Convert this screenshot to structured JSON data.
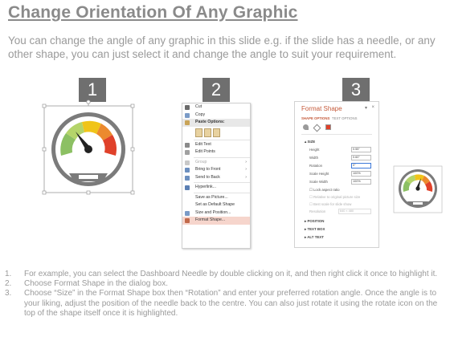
{
  "title": "Change Orientation Of Any Graphic",
  "intro": "You can change the angle of any graphic in this slide e.g. if the slide has a needle, or any other shape, you can just select it and change the angle to suit your requirement.",
  "step_numbers": [
    "1",
    "2",
    "3"
  ],
  "menu": {
    "cut": "Cut",
    "copy": "Copy",
    "paste_options": "Paste Options:",
    "edit_text": "Edit Text",
    "edit_points": "Edit Points",
    "group": "Group",
    "bring_to_front": "Bring to Front",
    "send_to_back": "Send to Back",
    "hyperlink": "Hyperlink...",
    "save_as_picture": "Save as Picture...",
    "set_default_shape": "Set as Default Shape",
    "size_and_position": "Size and Position...",
    "format_shape": "Format Shape..."
  },
  "pane": {
    "title": "Format Shape",
    "tab_shape": "SHAPE OPTIONS",
    "tab_text": "TEXT OPTIONS",
    "section_size": "SIZE",
    "height_label": "Height",
    "height_value": "0.55\"",
    "width_label": "Width",
    "width_value": "0.60\"",
    "rotation_label": "Rotation",
    "rotation_value": "0°",
    "scale_height_label": "Scale Height",
    "scale_height_value": "100%",
    "scale_width_label": "Scale Width",
    "scale_width_value": "100%",
    "lock_aspect": "Lock aspect ratio",
    "relative_original": "Relative to original picture size",
    "best_scale": "Best scale for slide show",
    "resolution_label": "Resolution",
    "resolution_value": "640 × 480",
    "section_position": "POSITION",
    "section_textbox": "TEXT BOX",
    "section_alttext": "ALT TEXT"
  },
  "steps": [
    {
      "n": "1.",
      "text": "For example, you can select the Dashboard Needle by double clicking on it, and then right click it once to highlight it."
    },
    {
      "n": "2.",
      "text": "Choose Format Shape in the dialog box."
    },
    {
      "n": "3.",
      "text": "Choose “Size” in the Format Shape box then “Rotation” and enter your preferred rotation angle. Once the angle is to your liking, adjust the position of the needle back to the centre. You can also just rotate it using the rotate icon on the top of the shape itself once it is highlighted."
    }
  ],
  "gauge_colors": {
    "green": "#8cc063",
    "lightgreen": "#b4d46a",
    "yellow": "#f0c419",
    "orange": "#ec8a2e",
    "red": "#e0412a",
    "grey": "#7b7b7b",
    "needle": "#222222"
  },
  "accent_color": "#c55a3a"
}
